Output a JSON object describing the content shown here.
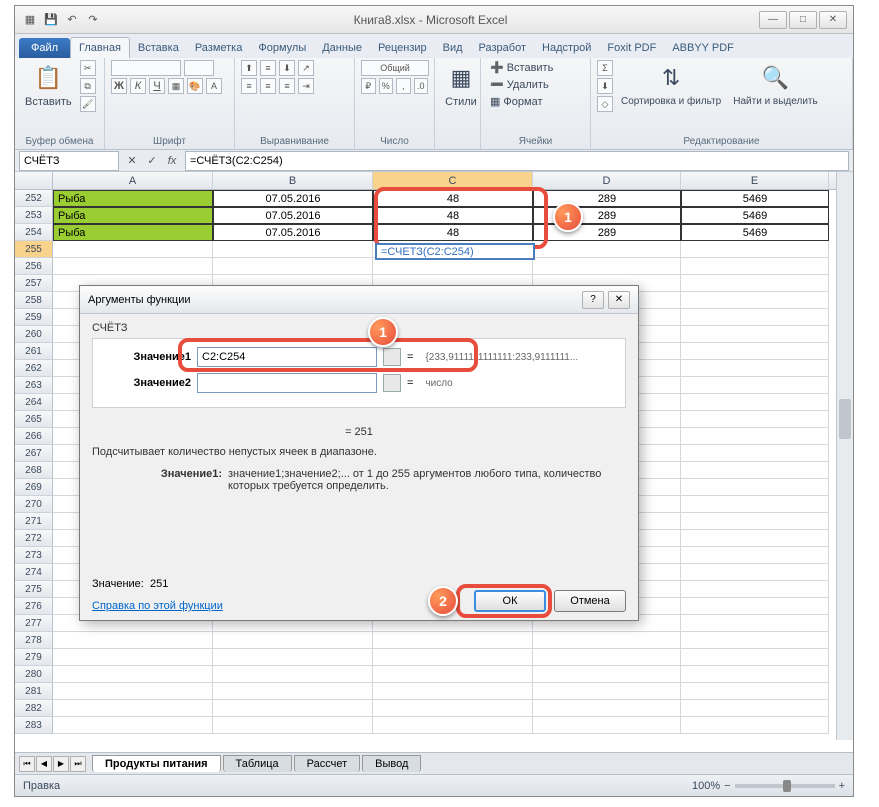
{
  "title": "Книга8.xlsx - Microsoft Excel",
  "tabs": {
    "file": "Файл",
    "home": "Главная",
    "insert": "Вставка",
    "layout": "Разметка",
    "formulas": "Формулы",
    "data": "Данные",
    "review": "Рецензир",
    "view": "Вид",
    "dev": "Разработ",
    "addins": "Надстрой",
    "foxit": "Foxit PDF",
    "abbyy": "ABBYY PDF"
  },
  "ribbon": {
    "clipboard": {
      "paste": "Вставить",
      "label": "Буфер обмена"
    },
    "font": {
      "label": "Шрифт"
    },
    "align": {
      "label": "Выравнивание"
    },
    "number": {
      "format": "Общий",
      "label": "Число"
    },
    "styles": {
      "btn": "Стили"
    },
    "cells": {
      "insert": "Вставить",
      "delete": "Удалить",
      "format": "Формат",
      "label": "Ячейки"
    },
    "editing": {
      "sort": "Сортировка и фильтр",
      "find": "Найти и выделить",
      "label": "Редактирование"
    }
  },
  "namebox": "СЧЁТЗ",
  "formula": "=СЧЁТЗ(C2:C254)",
  "formula_display": "=СЧЕТЗ(C2:C254)",
  "cols": [
    "A",
    "B",
    "C",
    "D",
    "E"
  ],
  "rows": [
    {
      "n": "252",
      "a": "Рыба",
      "b": "07.05.2016",
      "c": "48",
      "d": "289",
      "e": "5469"
    },
    {
      "n": "253",
      "a": "Рыба",
      "b": "07.05.2016",
      "c": "48",
      "d": "289",
      "e": "5469"
    },
    {
      "n": "254",
      "a": "Рыба",
      "b": "07.05.2016",
      "c": "48",
      "d": "289",
      "e": "5469"
    }
  ],
  "empty_rows": [
    "255",
    "256",
    "257",
    "258",
    "259",
    "260",
    "261",
    "262",
    "263",
    "264",
    "265",
    "266",
    "267",
    "268",
    "269",
    "270",
    "271",
    "272",
    "273",
    "274",
    "275",
    "276",
    "277",
    "278",
    "279",
    "280",
    "281",
    "282",
    "283"
  ],
  "dialog": {
    "title": "Аргументы функции",
    "fn": "СЧЁТЗ",
    "arg1_label": "Значение1",
    "arg1_value": "C2:C254",
    "arg1_result": "{233,9111111111111:233,9111111...",
    "arg2_label": "Значение2",
    "arg2_result": "число",
    "eq_result": "= 251",
    "desc": "Подсчитывает количество непустых ячеек в диапазоне.",
    "arg_desc_label": "Значение1:",
    "arg_desc": "значение1;значение2;... от 1 до 255 аргументов любого типа, количество которых требуется определить.",
    "value_label": "Значение:",
    "value": "251",
    "help": "Справка по этой функции",
    "ok": "ОК",
    "cancel": "Отмена"
  },
  "badges": {
    "one": "1",
    "two": "2"
  },
  "sheets": {
    "s1": "Продукты питания",
    "s2": "Таблица",
    "s3": "Рассчет",
    "s4": "Вывод"
  },
  "status": {
    "mode": "Правка",
    "zoom": "100%"
  }
}
